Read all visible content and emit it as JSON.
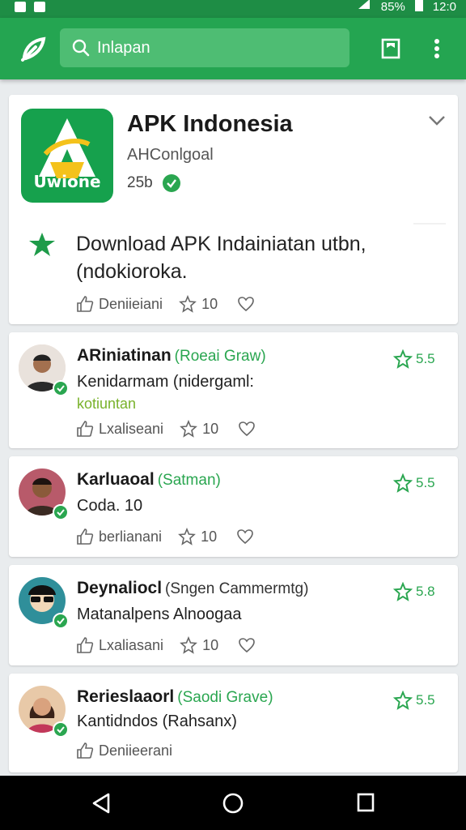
{
  "status_bar": {
    "battery": "85%",
    "time": "12:0"
  },
  "app_bar": {
    "search_query": "Inlapan",
    "icons": [
      "app-logo-icon",
      "search-icon",
      "bookmark-icon",
      "more-vert-icon"
    ]
  },
  "app": {
    "title": "APK Indonesia",
    "developer": "AHConlgoal",
    "size": "25b",
    "icon_text": "Uwione",
    "description_line1": "Download APK Indainiatan utbn,",
    "description_line2": "(ndokioroka.",
    "like_label": "Deniieiani",
    "star_count": "10"
  },
  "reviews": [
    {
      "name": "ARiniatinan",
      "tag": "(Roeai Graw)",
      "rating": "5.5",
      "text": "Kenidarmam (nidergaml:",
      "text2": "kotiuntan",
      "like_label": "Lxaliseani",
      "star_count": "10"
    },
    {
      "name": "Karluaoal",
      "tag": "(Satman)",
      "rating": "5.5",
      "text": "Coda. 10",
      "text2": "",
      "like_label": "berlianani",
      "star_count": "10"
    },
    {
      "name": "Deynaliocl",
      "tag": "(Sngen Cammermtg)",
      "rating": "5.8",
      "text": "Matanalpens Alnoogaa",
      "text2": "",
      "like_label": "Lxaliasani",
      "star_count": "10"
    },
    {
      "name": "Rerieslaaorl",
      "tag": "(Saodi Grave)",
      "rating": "5.5",
      "text": "Kantidndos (Rahsanx)",
      "text2": "",
      "like_label": "Deniieerani",
      "star_count": ""
    }
  ],
  "colors": {
    "primary": "#24a551",
    "status_bar": "#1e8d45",
    "accent_green": "#2aa650"
  }
}
